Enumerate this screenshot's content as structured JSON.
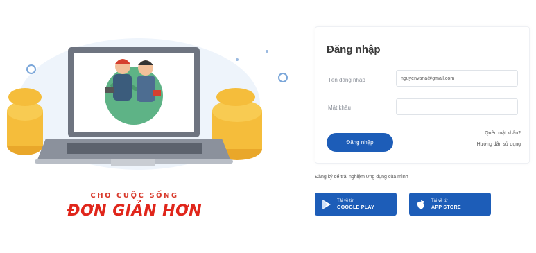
{
  "hero": {
    "slogan_top": "CHO CUỘC SỐNG",
    "slogan_main": "ĐƠN GIẢN HƠN",
    "illustration": "laptop-with-two-people-and-coins",
    "colors": {
      "brand_red": "#e0261b",
      "coin": "#f5bd3b",
      "screen_frame": "#6e7480"
    }
  },
  "login": {
    "title": "Đăng nhập",
    "username_label": "Tên đăng nhập",
    "username_value": "nguyenvana@gmail.com",
    "password_label": "Mật khẩu",
    "password_value": "",
    "submit_label": "Đăng nhập",
    "forgot_link": "Quên mật khẩu?",
    "guide_link": "Hướng dẫn sử dụng"
  },
  "app": {
    "note": "Đăng ký để trải nghiệm ứng dụng của mình",
    "google_play": {
      "small": "Tải về từ",
      "big": "GOOGLE PLAY",
      "icon": "google-play-icon"
    },
    "app_store": {
      "small": "Tải về từ",
      "big": "APP STORE",
      "icon": "apple-icon"
    }
  },
  "colors": {
    "primary": "#1d5db8",
    "text": "#3a3a3a"
  }
}
